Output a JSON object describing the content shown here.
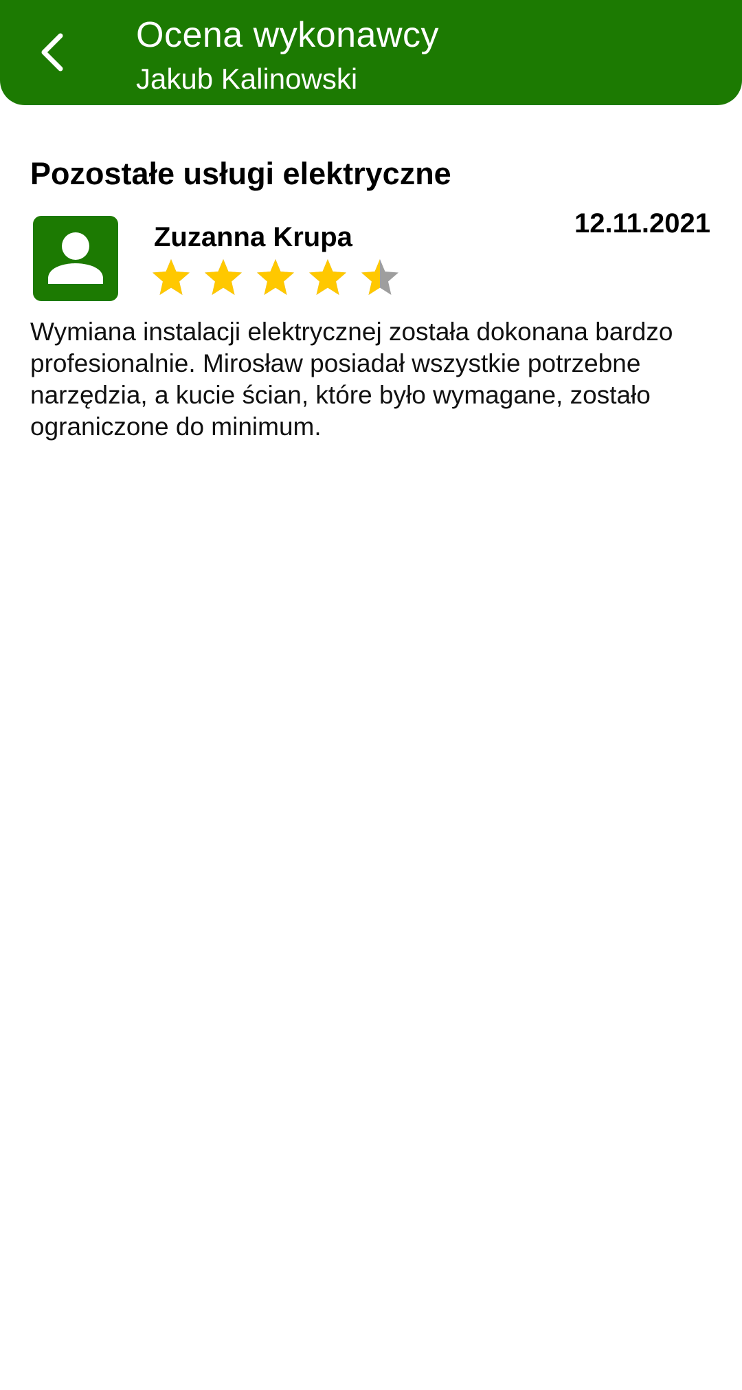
{
  "app_bar": {
    "title": "Ocena wykonawcy",
    "subtitle": "Jakub Kalinowski",
    "back_icon": "chevron-left-icon",
    "background_color": "#1c7a02"
  },
  "section": {
    "title": "Pozostałe usługi elektryczne"
  },
  "review": {
    "avatar_icon": "person-icon",
    "reviewer_name": "Zuzanna Krupa",
    "date": "12.11.2021",
    "rating": 4.5,
    "rating_max": 5,
    "star_color": "#ffc800",
    "star_empty_color": "#9e9e9e",
    "text": "Wymiana instalacji elektrycznej została dokonana bardzo profesionalnie. Mirosław posiadał wszystkie potrzebne narzędzia, a kucie ścian, które było wymagane, zostało ograniczone do minimum."
  }
}
